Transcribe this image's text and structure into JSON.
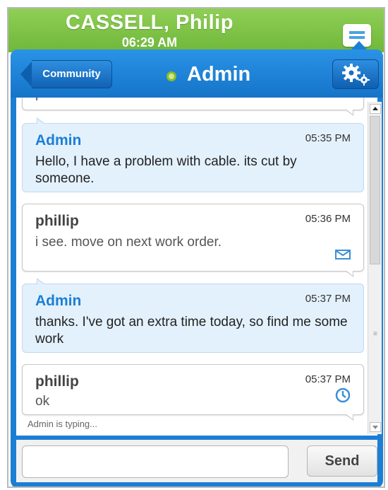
{
  "status_bar": {
    "user_name": "CASSELL, Philip",
    "time": "06:29 AM"
  },
  "header": {
    "back_label": "Community",
    "title": "Admin",
    "status_color": "#8bbd2a"
  },
  "partial_message": {
    "text": "r"
  },
  "messages": [
    {
      "sender": "Admin",
      "time": "05:35 PM",
      "text": "Hello, I have a problem with cable. its cut by someone.",
      "kind": "admin",
      "status_icon": ""
    },
    {
      "sender": "phillip",
      "time": "05:36 PM",
      "text": "i see. move on next work order.",
      "kind": "user",
      "status_icon": "envelope-icon"
    },
    {
      "sender": "Admin",
      "time": "05:37 PM",
      "text": "thanks. I've got an extra time today, so find me some work",
      "kind": "admin",
      "status_icon": ""
    },
    {
      "sender": "phillip",
      "time": "05:37 PM",
      "text": "ok",
      "kind": "user",
      "status_icon": "clock-icon"
    }
  ],
  "typing_indicator": "Admin is typing...",
  "composer": {
    "input_value": "",
    "input_placeholder": "",
    "send_label": "Send"
  },
  "colors": {
    "top_bar": "#6fb73a",
    "panel_blue": "#1b7fd4",
    "admin_bubble": "#e3f1fd",
    "admin_name": "#1b7fd4"
  }
}
